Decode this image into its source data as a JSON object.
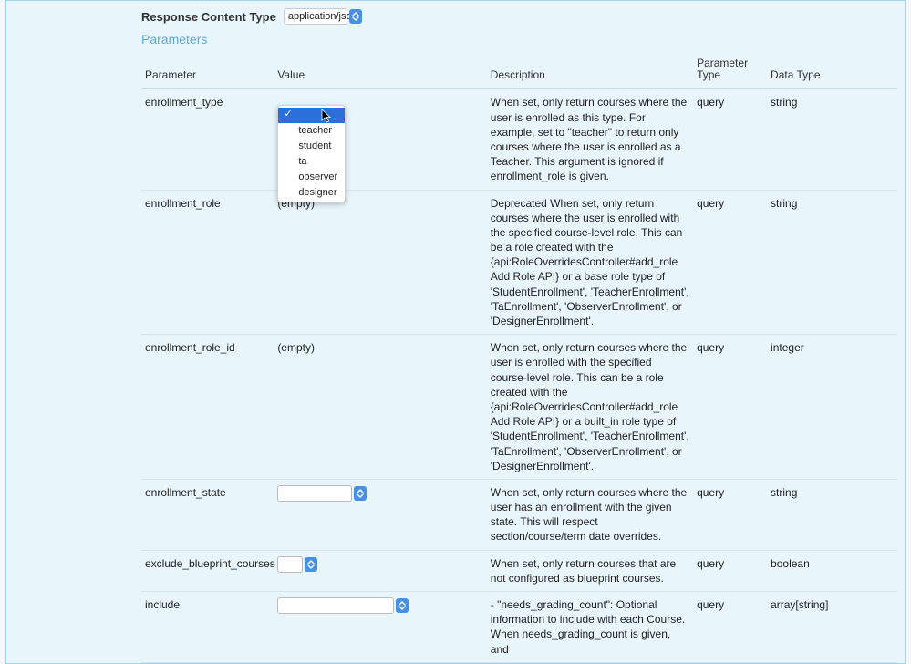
{
  "responseContentType": {
    "label": "Response Content Type",
    "value": "application/json"
  },
  "parametersHeading": "Parameters",
  "headers": {
    "parameter": "Parameter",
    "value": "Value",
    "description": "Description",
    "parameterType": "Parameter Type",
    "dataType": "Data Type"
  },
  "enrollmentTypeOptions": [
    "",
    "teacher",
    "student",
    "ta",
    "observer",
    "designer"
  ],
  "rows": [
    {
      "parameter": "enrollment_type",
      "value": "",
      "valueKind": "dropdown-open",
      "description": "When set, only return courses where the user is enrolled as this type. For example, set to \"teacher\" to return only courses where the user is enrolled as a Teacher. This argument is ignored if enrollment_role is given.",
      "ptype": "query",
      "dtype": "string"
    },
    {
      "parameter": "enrollment_role",
      "value": "(empty)",
      "valueKind": "text",
      "description": "Deprecated When set, only return courses where the user is enrolled with the specified course-level role. This can be a role created with the {api:RoleOverridesController#add_role Add Role API} or a base role type of 'StudentEnrollment', 'TeacherEnrollment', 'TaEnrollment', 'ObserverEnrollment', or 'DesignerEnrollment'.",
      "ptype": "query",
      "dtype": "string"
    },
    {
      "parameter": "enrollment_role_id",
      "value": "(empty)",
      "valueKind": "text",
      "description": "When set, only return courses where the user is enrolled with the specified course-level role. This can be a role created with the {api:RoleOverridesController#add_role Add Role API} or a built_in role type of 'StudentEnrollment', 'TeacherEnrollment', 'TaEnrollment', 'ObserverEnrollment', or 'DesignerEnrollment'.",
      "ptype": "query",
      "dtype": "integer"
    },
    {
      "parameter": "enrollment_state",
      "value": "",
      "valueKind": "select",
      "selectWidth": 82,
      "description": "When set, only return courses where the user has an enrollment with the given state. This will respect section/course/term date overrides.",
      "ptype": "query",
      "dtype": "string"
    },
    {
      "parameter": "exclude_blueprint_courses",
      "value": "",
      "valueKind": "select",
      "selectWidth": 28,
      "description": "When set, only return courses that are not configured as blueprint courses.",
      "ptype": "query",
      "dtype": "boolean"
    },
    {
      "parameter": "include",
      "value": "",
      "valueKind": "select",
      "selectWidth": 128,
      "description": "- \"needs_grading_count\": Optional information to include with each Course. When needs_grading_count is given, and",
      "ptype": "query",
      "dtype": "array[string]"
    }
  ]
}
